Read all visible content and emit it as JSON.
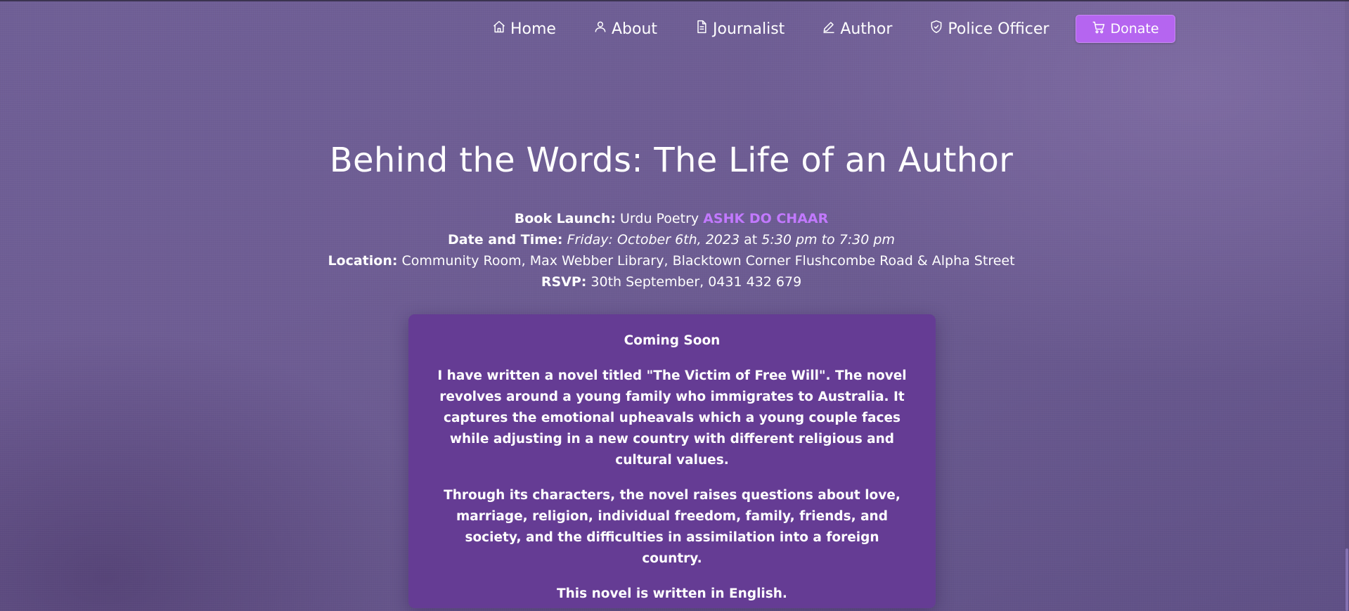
{
  "nav": {
    "items": [
      {
        "label": "Home",
        "icon": "home-icon"
      },
      {
        "label": "About",
        "icon": "user-icon"
      },
      {
        "label": "Journalist",
        "icon": "document-icon"
      },
      {
        "label": "Author",
        "icon": "pen-icon"
      },
      {
        "label": "Police Officer",
        "icon": "shield-icon"
      }
    ],
    "donate_label": "Donate",
    "donate_icon": "cart-icon"
  },
  "hero": {
    "title": "Behind the Words: The Life of an Author",
    "book_launch_label": "Book Launch:",
    "book_launch_text": "Urdu Poetry",
    "book_launch_highlight": "ASHK DO CHAAR",
    "datetime_label": "Date and Time:",
    "date": "Friday: October 6th, 2023",
    "at": "at",
    "time": "5:30 pm to 7:30 pm",
    "location_label": "Location:",
    "location": "Community Room, Max Webber Library, Blacktown Corner Flushcombe Road & Alpha Street",
    "rsvp_label": "RSVP:",
    "rsvp": "30th September, 0431 432 679"
  },
  "card": {
    "heading": "Coming Soon",
    "paragraphs": [
      "I have written a novel titled \"The Victim of Free Will\". The novel revolves around a young family who immigrates to Australia. It captures the emotional upheavals which a young couple faces while adjusting in a new country with different religious and cultural values.",
      "Through its characters, the novel raises questions about love, marriage, religion, individual freedom, family, friends, and society, and the difficulties in assimilation into a foreign country.",
      "This novel is written in English."
    ]
  },
  "colors": {
    "background": "#6e5d94",
    "card": "#653c94",
    "accent": "#b565f0",
    "highlight": "#c279ff"
  }
}
